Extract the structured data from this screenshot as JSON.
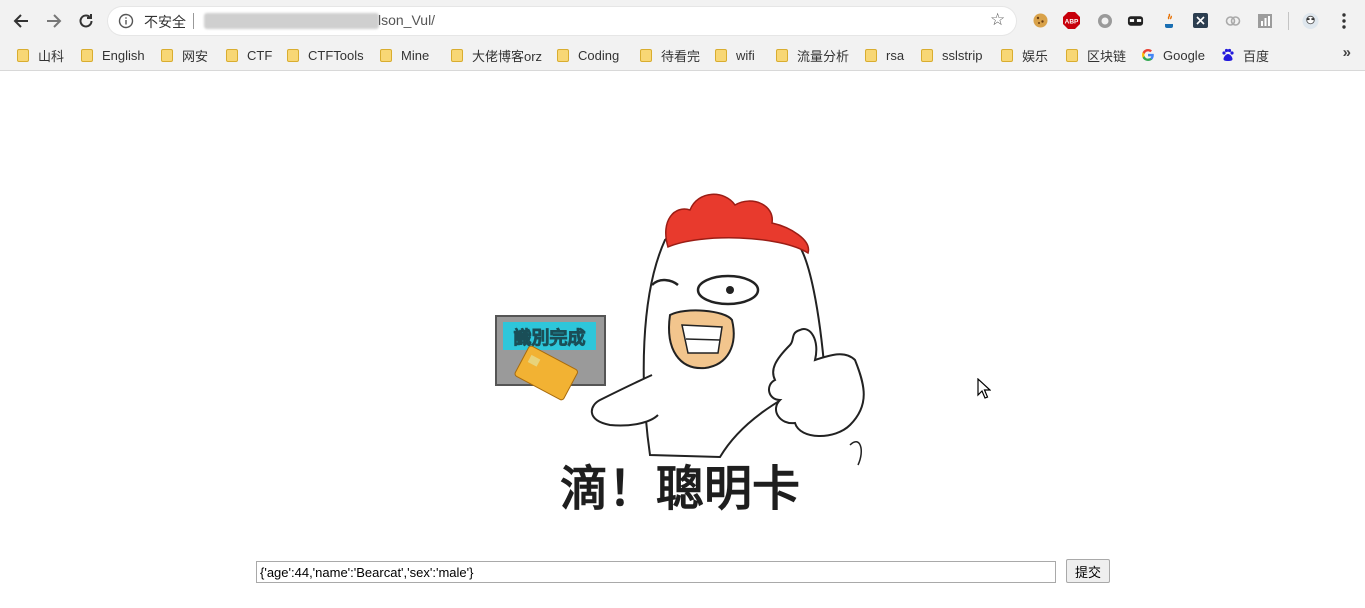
{
  "toolbar": {
    "security_label": "不安全",
    "url_visible": "lson_Vul/"
  },
  "bookmarks": [
    {
      "label": "山科",
      "icon": "folder-icon"
    },
    {
      "label": "English",
      "icon": "folder-icon"
    },
    {
      "label": "网安",
      "icon": "folder-icon"
    },
    {
      "label": "CTF",
      "icon": "folder-icon"
    },
    {
      "label": "CTFTools",
      "icon": "folder-icon"
    },
    {
      "label": "Mine",
      "icon": "folder-icon"
    },
    {
      "label": "大佬博客orz",
      "icon": "folder-icon"
    },
    {
      "label": "Coding",
      "icon": "folder-icon"
    },
    {
      "label": "待看完",
      "icon": "folder-icon"
    },
    {
      "label": "wifi",
      "icon": "folder-icon"
    },
    {
      "label": "流量分析",
      "icon": "folder-icon"
    },
    {
      "label": "rsa",
      "icon": "folder-icon"
    },
    {
      "label": "sslstrip",
      "icon": "folder-icon"
    },
    {
      "label": "娱乐",
      "icon": "folder-icon"
    },
    {
      "label": "区块链",
      "icon": "folder-icon"
    },
    {
      "label": "Google",
      "icon": "google-icon"
    },
    {
      "label": "百度",
      "icon": "baidu-icon"
    }
  ],
  "extensions": {
    "abp_label": "ABP"
  },
  "main": {
    "card_reader_text": "識別完成",
    "caption": "滴！聰明卡",
    "json_input_value": "{'age':44,'name':'Bearcat','sex':'male'}",
    "submit_label": "提交"
  }
}
